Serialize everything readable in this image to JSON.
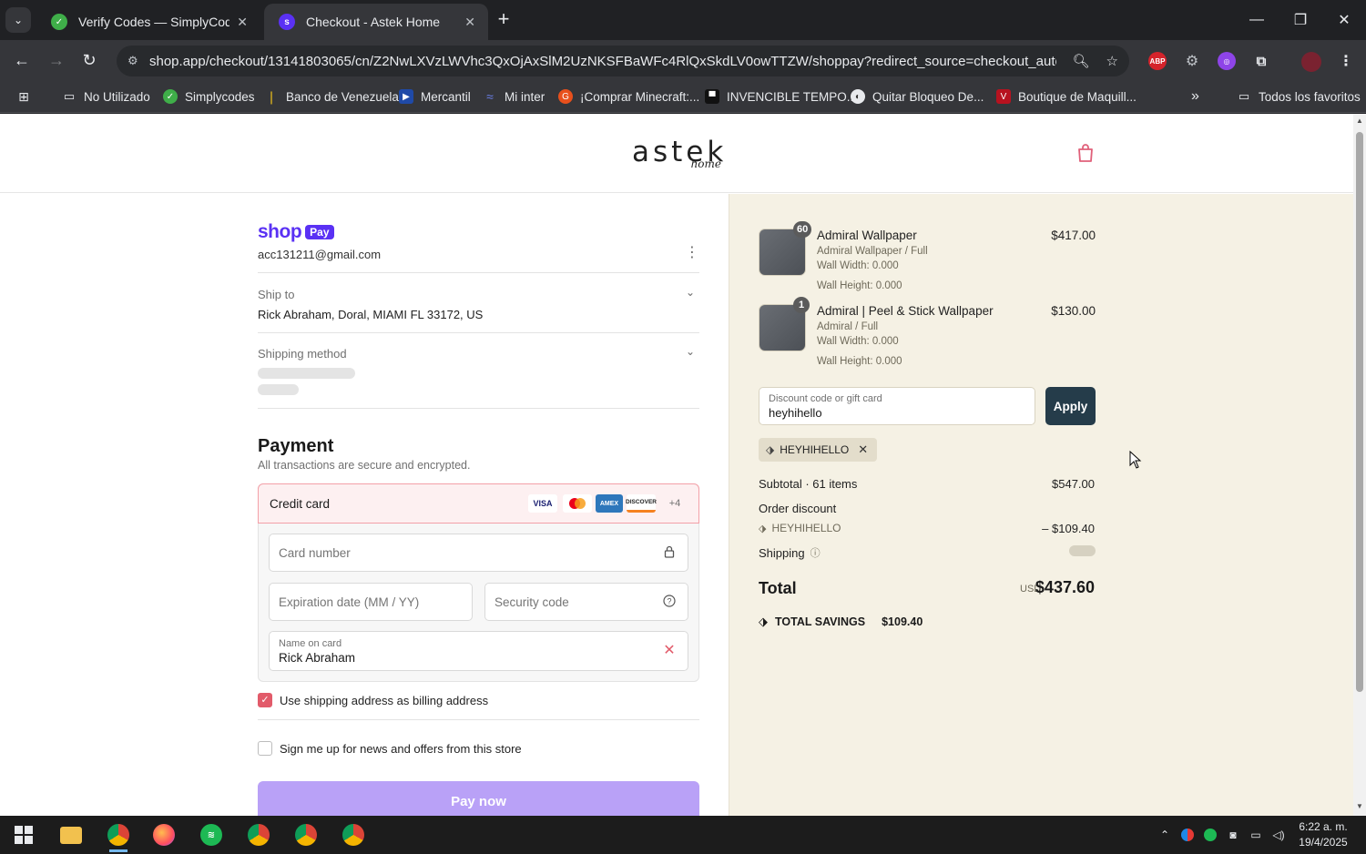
{
  "browser": {
    "tabs": [
      {
        "title": "Verify Codes — SimplyCodes",
        "active": false
      },
      {
        "title": "Checkout - Astek Home",
        "active": true
      }
    ],
    "url": "shop.app/checkout/13141803065/cn/Z2NwLXVzLWVhc3QxOjAxSlM2UzNKSFBaWFc4RlQxSkdLV0owTTZW/shoppay?redirect_source=checkout_automatic_redirect",
    "bookmarks": [
      {
        "label": "No Utilizado",
        "icon": "folder-icon"
      },
      {
        "label": "Simplycodes",
        "icon": "simplycodes-icon"
      },
      {
        "label": "Banco de Venezuela",
        "icon": "bank-icon"
      },
      {
        "label": "Mercantil",
        "icon": "mercantil-icon"
      },
      {
        "label": "Mi inter",
        "icon": "inter-icon"
      },
      {
        "label": "¡Comprar Minecraft:...",
        "icon": "minecraft-icon"
      },
      {
        "label": "INVENCIBLE TEMPO...",
        "icon": "tv-icon"
      },
      {
        "label": "Quitar Bloqueo De...",
        "icon": "unlock-icon"
      },
      {
        "label": "Boutique de Maquill...",
        "icon": "boutique-icon"
      }
    ],
    "all_bookmarks_label": "Todos los favoritos",
    "extensions": [
      "abp-icon",
      "gear-icon",
      "extension-purple-icon",
      "puzzle-icon",
      "profile-avatar-icon"
    ]
  },
  "store": {
    "logo_main": "astek",
    "logo_sub": "home"
  },
  "checkout": {
    "brand": {
      "shop": "shop",
      "pay": "Pay"
    },
    "email": "acc131211@gmail.com",
    "ship_to_label": "Ship to",
    "ship_to_value": "Rick Abraham, Doral, MIAMI FL 33172, US",
    "shipping_method_label": "Shipping method",
    "payment_title": "Payment",
    "payment_subtitle": "All transactions are secure and encrypted.",
    "credit_card_label": "Credit card",
    "card_brands": [
      "VISA",
      "mastercard",
      "AMEX",
      "DISCOVER"
    ],
    "more_brands": "+4",
    "card_number_placeholder": "Card number",
    "expiration_placeholder": "Expiration date (MM / YY)",
    "security_code_placeholder": "Security code",
    "name_on_card_label": "Name on card",
    "name_on_card_value": "Rick Abraham",
    "billing_same_label": "Use shipping address as billing address",
    "billing_same_checked": true,
    "newsletter_label": "Sign me up for news and offers from this store",
    "newsletter_checked": false,
    "pay_now_label": "Pay now"
  },
  "summary": {
    "items": [
      {
        "qty": "60",
        "name": "Admiral Wallpaper",
        "variant": "Admiral Wallpaper / Full",
        "width": "Wall Width: 0.000",
        "height": "Wall Height: 0.000",
        "price": "$417.00"
      },
      {
        "qty": "1",
        "name": "Admiral | Peel & Stick Wallpaper",
        "variant": "Admiral / Full",
        "width": "Wall Width: 0.000",
        "height": "Wall Height: 0.000",
        "price": "$130.00"
      }
    ],
    "discount_label": "Discount code or gift card",
    "discount_value": "heyhihello",
    "apply_label": "Apply",
    "applied_code": "HEYHIHELLO",
    "subtotal_label": "Subtotal · 61 items",
    "subtotal_value": "$547.00",
    "order_discount_label": "Order discount",
    "order_discount_code": "HEYHIHELLO",
    "order_discount_value": "– $109.40",
    "shipping_label": "Shipping",
    "total_label": "Total",
    "total_currency": "USD",
    "total_value": "$437.60",
    "savings_label": "TOTAL SAVINGS",
    "savings_value": "$109.40"
  },
  "taskbar": {
    "time": "6:22 a. m.",
    "date": "19/4/2025"
  },
  "colors": {
    "shop_purple": "#5a31f4",
    "apply_button": "#253c4a",
    "summary_bg": "#f5f1e4",
    "credit_card_highlight": "#fdf0f1",
    "checkbox_on": "#e25b6a",
    "pay_now": "#b9a1f7"
  }
}
